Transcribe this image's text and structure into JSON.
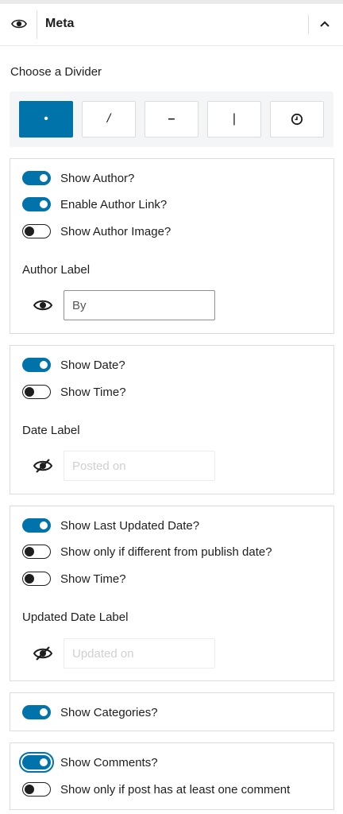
{
  "header": {
    "title": "Meta",
    "eye_icon": "eye-icon",
    "collapse_icon": "chevron-up-icon"
  },
  "divider": {
    "label": "Choose a Divider",
    "options": [
      {
        "symbol": "•",
        "name": "dot",
        "selected": true
      },
      {
        "symbol": "/",
        "name": "slash",
        "selected": false
      },
      {
        "symbol": "–",
        "name": "dash",
        "selected": false
      },
      {
        "symbol": "|",
        "name": "pipe",
        "selected": false
      },
      {
        "symbol": "",
        "name": "clock",
        "selected": false
      }
    ]
  },
  "author": {
    "show_author": {
      "label": "Show Author?",
      "on": true
    },
    "enable_link": {
      "label": "Enable Author Link?",
      "on": true
    },
    "show_image": {
      "label": "Show Author Image?",
      "on": false
    },
    "field_label": "Author Label",
    "field_value": "By",
    "visibility_icon": "eye-icon"
  },
  "date": {
    "show_date": {
      "label": "Show Date?",
      "on": true
    },
    "show_time": {
      "label": "Show Time?",
      "on": false
    },
    "field_label": "Date Label",
    "placeholder": "Posted on",
    "visibility_icon": "eye-slash-icon"
  },
  "updated": {
    "show_updated": {
      "label": "Show Last Updated Date?",
      "on": true
    },
    "only_different": {
      "label": "Show only if different from publish date?",
      "on": false
    },
    "show_time": {
      "label": "Show Time?",
      "on": false
    },
    "field_label": "Updated Date Label",
    "placeholder": "Updated on",
    "visibility_icon": "eye-slash-icon"
  },
  "categories": {
    "show_categories": {
      "label": "Show Categories?",
      "on": true
    }
  },
  "comments": {
    "show_comments": {
      "label": "Show Comments?",
      "on": true
    },
    "only_if_comment": {
      "label": "Show only if post has at least one comment",
      "on": false
    }
  },
  "colors": {
    "accent": "#0073aa",
    "border": "#dcdcde",
    "text": "#1e1e1e"
  }
}
